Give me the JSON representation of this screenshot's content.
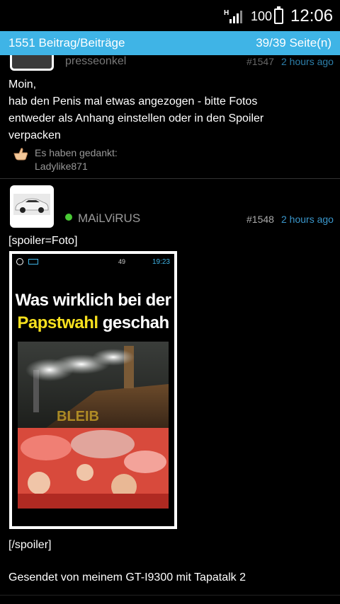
{
  "status_bar": {
    "network": "H",
    "battery": "100",
    "time": "12:06"
  },
  "header": {
    "post_count": "1551 Beitrag/Beiträge",
    "pages": "39/39 Seite(n)"
  },
  "posts": [
    {
      "username": "presseonkel",
      "post_number": "#1547",
      "time": "2 hours ago",
      "body_lines": [
        "Moin,",
        "hab den Penis mal etwas angezogen - bitte Fotos",
        "entweder als Anhang einstellen oder in den Spoiler",
        "verpacken"
      ],
      "thanks_label": "Es haben gedankt:",
      "thanks_user": "Ladylike871"
    },
    {
      "username": "MAiLViRUS",
      "post_number": "#1548",
      "time": "2 hours ago",
      "spoiler_open": "[spoiler=Foto]",
      "spoiler_close": "[/spoiler]",
      "signature": "Gesendet von meinem GT-I9300 mit Tapatalk 2",
      "image": {
        "status_time": "19:23",
        "status_icons": "49",
        "title_line1": "Was wirklich bei der",
        "title_highlight": "Papstwahl",
        "title_rest": "geschah",
        "watermark": "BLEIB"
      }
    }
  ],
  "colors": {
    "header_bg": "#3fb4e6",
    "timestamp": "#3a97cc",
    "online": "#49c935",
    "highlight": "#f6e01e"
  }
}
